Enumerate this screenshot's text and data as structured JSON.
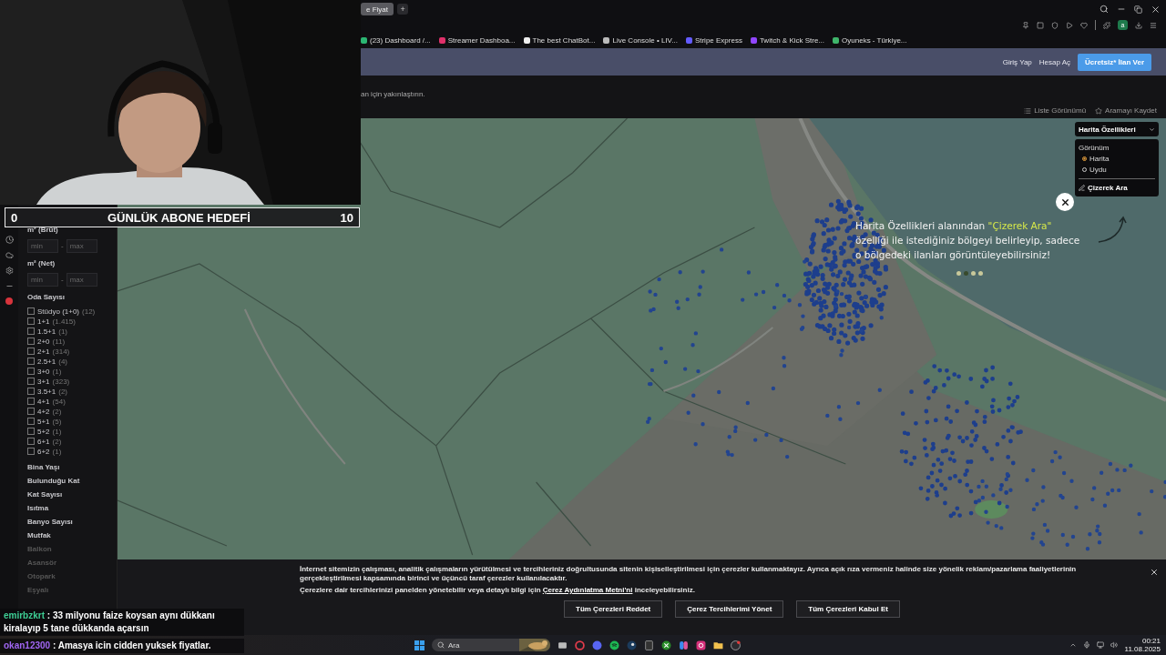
{
  "browser": {
    "tabs": [
      {
        "label": "e Fiyat",
        "selected": true
      }
    ],
    "new_tab": "+",
    "profile_initial": "a",
    "bookmarks": [
      "(23) Dashboard /...",
      "Streamer Dashboa...",
      "The best ChatBot...",
      "Live Console • LIV...",
      "Stripe Express",
      "Twitch & Kick Stre...",
      "Oyuneks - Türkiye..."
    ]
  },
  "header": {
    "links": [
      "Giriş Yap",
      "Hesap Aç"
    ],
    "cta": "Ücretsiz* İlan Ver"
  },
  "subbar": {
    "hint": "an için yakınlaştırın.",
    "actions": [
      {
        "kind": "list",
        "label": "Liste Görünümü"
      },
      {
        "kind": "save",
        "label": "Aramayı Kaydet"
      }
    ]
  },
  "filters": {
    "area_groups": [
      {
        "title": "m² (Brüt)",
        "min_placeholder": "min",
        "separator": "-",
        "max_placeholder": "max"
      },
      {
        "title": "m² (Net)",
        "min_placeholder": "min",
        "separator": "-",
        "max_placeholder": "max"
      }
    ],
    "room_title": "Oda Sayısı",
    "rooms": [
      {
        "label": "Stüdyo (1+0)",
        "count": "(12)",
        "checked": false
      },
      {
        "label": "1+1",
        "count": "(1.415)",
        "checked": false
      },
      {
        "label": "1.5+1",
        "count": "(1)",
        "checked": false
      },
      {
        "label": "2+0",
        "count": "(11)",
        "checked": false
      },
      {
        "label": "2+1",
        "count": "(314)",
        "checked": false
      },
      {
        "label": "2.5+1",
        "count": "(4)",
        "checked": false
      },
      {
        "label": "3+0",
        "count": "(1)",
        "checked": false
      },
      {
        "label": "3+1",
        "count": "(323)",
        "checked": false
      },
      {
        "label": "3.5+1",
        "count": "(2)",
        "checked": false
      },
      {
        "label": "4+1",
        "count": "(54)",
        "checked": false
      },
      {
        "label": "4+2",
        "count": "(2)",
        "checked": false
      },
      {
        "label": "5+1",
        "count": "(5)",
        "checked": false
      },
      {
        "label": "5+2",
        "count": "(1)",
        "checked": false
      },
      {
        "label": "6+1",
        "count": "(2)",
        "checked": false
      },
      {
        "label": "6+2",
        "count": "(1)",
        "checked": false
      }
    ],
    "sections": [
      {
        "label": "Bina Yaşı",
        "faded": false
      },
      {
        "label": "Bulunduğu Kat",
        "faded": false
      },
      {
        "label": "Kat Sayısı",
        "faded": false
      },
      {
        "label": "Isıtma",
        "faded": false
      },
      {
        "label": "Banyo Sayısı",
        "faded": false
      },
      {
        "label": "Mutfak",
        "faded": false
      },
      {
        "label": "Balkon",
        "faded": true
      },
      {
        "label": "Asansör",
        "faded": true
      },
      {
        "label": "Otopark",
        "faded": true
      },
      {
        "label": "Eşyalı",
        "faded": true
      }
    ]
  },
  "map": {
    "kind": "picture",
    "features_panel": {
      "title": "Harita Özellikleri",
      "view_label": "Görünüm",
      "views": [
        {
          "label": "Harita",
          "selected": true
        },
        {
          "label": "Uydu",
          "selected": false
        }
      ],
      "draw_search": "Çizerek Ara"
    },
    "tip": {
      "text_before": "Harita Özellikleri alanından ",
      "highlight": "\"Çizerek Ara\"",
      "text_after": " özelliği ile istediğiniz bölgeyi belirleyip, sadece o bölgedeki ilanları görüntüleyebilirsiniz!",
      "pager": [
        {
          "selected": false
        },
        {
          "selected": true
        },
        {
          "selected": false
        },
        {
          "selected": false
        }
      ]
    }
  },
  "cookie": {
    "paragraph": "İnternet sitemizin çalışması, analitik çalışmaların yürütülmesi ve tercihleriniz doğrultusunda sitenin kişiselleştirilmesi için çerezler kullanmaktayız. Ayrıca açık rıza vermeniz halinde size yönelik reklam/pazarlama faaliyetlerinin gerçekleştirilmesi kapsamında birinci ve üçüncü taraf çerezler kullanılacaktır.",
    "detail_before": "Çerezlere dair tercihlerinizi panelden yönetebilir veya detaylı bilgi için ",
    "detail_link": "Çerez Aydınlatma Metni'ni",
    "detail_after": " inceleyebilirsiniz.",
    "buttons": [
      "Tüm Çerezleri Reddet",
      "Çerez Tercihlerimi Yönet",
      "Tüm Çerezleri Kabul Et"
    ]
  },
  "taskbar": {
    "search_label": "Ara",
    "time": "00:21",
    "date": "11.08.2025"
  },
  "stream": {
    "goal": {
      "current": "0",
      "title": "GÜNLÜK ABONE HEDEFİ",
      "target": "10"
    },
    "chat": [
      {
        "user": "emirbzkrt",
        "color": "#3ecf95",
        "message": ": 33 milyonu faize koysan aynı dükkanı kiralayıp 5 tane dükkanda açarsın"
      },
      {
        "user": "okan12300",
        "color": "#a066f2",
        "message": ": Amasya icin cidden yuksek fiyatlar."
      }
    ]
  }
}
